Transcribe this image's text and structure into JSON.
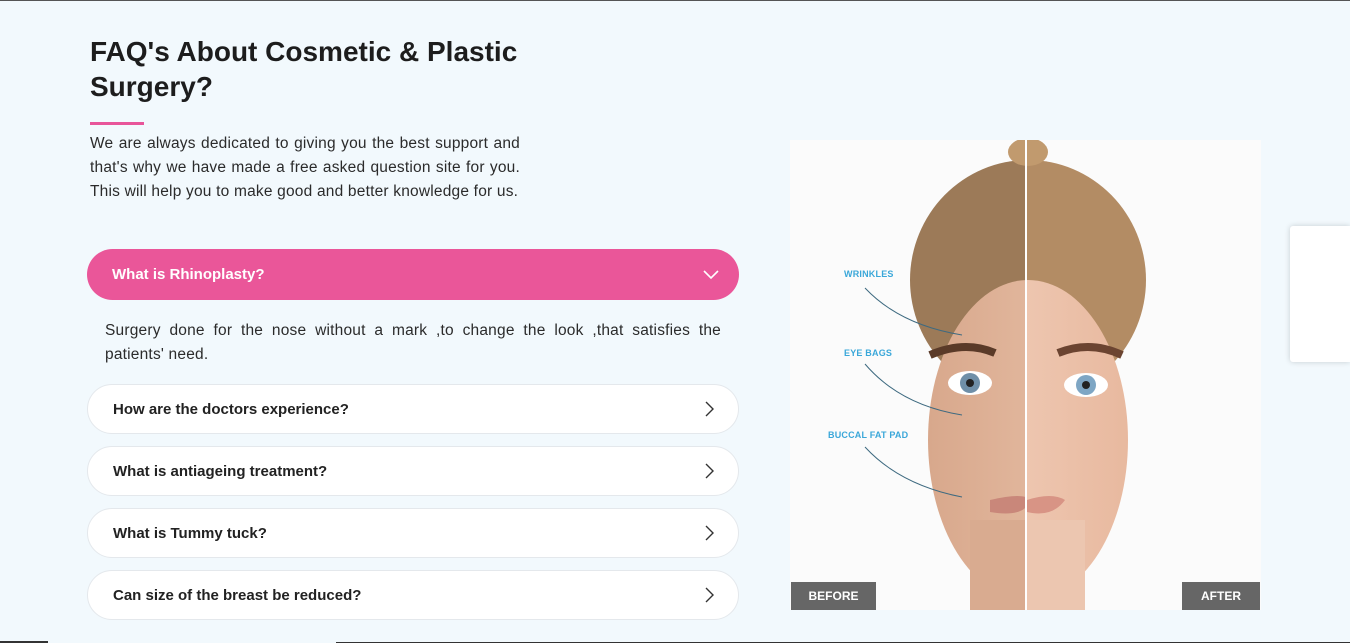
{
  "section": {
    "title": "FAQ's About Cosmetic & Plastic Surgery?",
    "intro": "We are always dedicated to giving you the best support and that's why we have made a free asked question site for you. This will help you to make good and better knowledge for us."
  },
  "faqs": [
    {
      "question": "What is Rhinoplasty?",
      "expanded": true,
      "icon": "chevron-down-icon",
      "answer": "Surgery done for the nose without a mark ,to change the look ,that satisfies the patients' need."
    },
    {
      "question": "How are the doctors experience?",
      "expanded": false,
      "icon": "chevron-right-icon"
    },
    {
      "question": "What is antiageing treatment?",
      "expanded": false,
      "icon": "chevron-right-icon"
    },
    {
      "question": "What is Tummy tuck?",
      "expanded": false,
      "icon": "chevron-right-icon"
    },
    {
      "question": "Can size of the breast be reduced?",
      "expanded": false,
      "icon": "chevron-right-icon"
    }
  ],
  "comparison": {
    "labels": [
      "WRINKLES",
      "EYE BAGS",
      "BUCCAL FAT PAD"
    ],
    "before_tag": "BEFORE",
    "after_tag": "AFTER"
  },
  "colors": {
    "accent": "#ea5699",
    "background": "#f2f9fd",
    "label_blue": "#3aa7d9",
    "tag_gray": "#666666"
  }
}
